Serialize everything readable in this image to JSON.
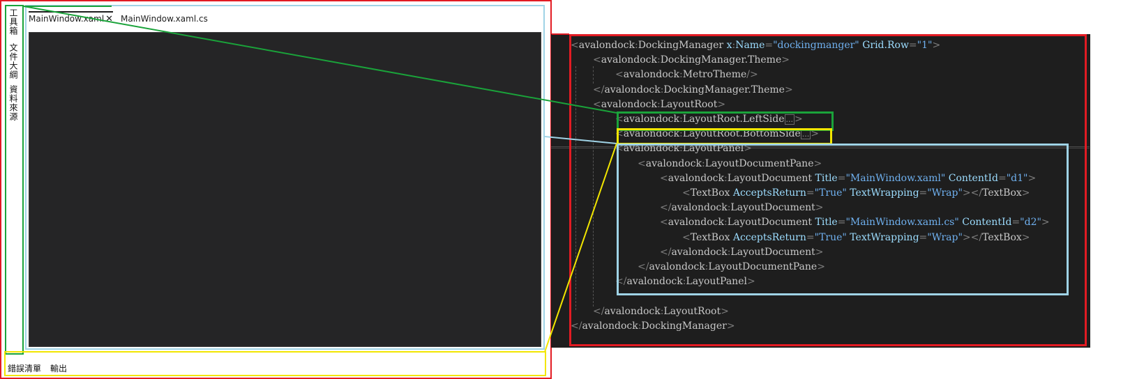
{
  "app_window": {
    "tabs": [
      {
        "label": "MainWindow.xaml",
        "close": "✕",
        "active": true
      },
      {
        "label": "MainWindow.xaml.cs",
        "active": false
      }
    ],
    "left_side": [
      "工具箱",
      "文件大綱",
      "資料來源"
    ],
    "bottom_side": [
      "錯誤清單",
      "輸出"
    ]
  },
  "code": {
    "lines": [
      {
        "indent": 0,
        "html": "<span class=\"p\">&lt;</span><span class=\"ns\">avalondock</span><span class=\"p\">:</span><span class=\"t\">DockingManager</span> <span class=\"a\">x</span><span class=\"p\">:</span><span class=\"a\">Name</span><span class=\"p\">=</span><span class=\"s\">\"dockingmanger\"</span> <span class=\"a\">Grid.Row</span><span class=\"p\">=</span><span class=\"s\">\"1\"</span><span class=\"p\">&gt;</span>"
      },
      {
        "indent": 1,
        "html": "<span class=\"p\">&lt;</span><span class=\"ns\">avalondock</span><span class=\"p\">:</span><span class=\"t\">DockingManager.Theme</span><span class=\"p\">&gt;</span>"
      },
      {
        "indent": 2,
        "html": "<span class=\"p\">&lt;</span><span class=\"ns\">avalondock</span><span class=\"p\">:</span><span class=\"t\">MetroTheme</span><span class=\"p\">/&gt;</span>"
      },
      {
        "indent": 1,
        "html": "<span class=\"p\">&lt;/</span><span class=\"ns\">avalondock</span><span class=\"p\">:</span><span class=\"t\">DockingManager.Theme</span><span class=\"p\">&gt;</span>"
      },
      {
        "indent": 1,
        "html": "<span class=\"p\">&lt;</span><span class=\"ns\">avalondock</span><span class=\"p\">:</span><span class=\"t\">LayoutRoot</span><span class=\"p\">&gt;</span>"
      },
      {
        "indent": 2,
        "html": "<span class=\"p\">&lt;</span><span class=\"ns\">avalondock</span><span class=\"p\">:</span><span class=\"t\">LayoutRoot.LeftSide</span><span class=\"ell\">...</span><span class=\"p\">&gt;</span>"
      },
      {
        "indent": 2,
        "html": "<span class=\"p\">&lt;</span><span class=\"ns\">avalondock</span><span class=\"p\">:</span><span class=\"t\">LayoutRoot.BottomSide</span><span class=\"ell\">...</span><span class=\"p\">&gt;</span>"
      },
      {
        "indent": 2,
        "html": "<span class=\"p\">&lt;</span><span class=\"ns\">avalondock</span><span class=\"p\">:</span><span class=\"t\">LayoutPanel</span><span class=\"p\">&gt;</span>"
      },
      {
        "indent": 3,
        "html": "<span class=\"p\">&lt;</span><span class=\"ns\">avalondock</span><span class=\"p\">:</span><span class=\"t\">LayoutDocumentPane</span><span class=\"p\">&gt;</span>"
      },
      {
        "indent": 4,
        "html": "<span class=\"p\">&lt;</span><span class=\"ns\">avalondock</span><span class=\"p\">:</span><span class=\"t\">LayoutDocument</span> <span class=\"a\">Title</span><span class=\"p\">=</span><span class=\"s\">\"MainWindow.xaml\"</span> <span class=\"a\">ContentId</span><span class=\"p\">=</span><span class=\"s\">\"d1\"</span><span class=\"p\">&gt;</span>"
      },
      {
        "indent": 5,
        "html": "<span class=\"p\">&lt;</span><span class=\"t\">TextBox</span> <span class=\"a\">AcceptsReturn</span><span class=\"p\">=</span><span class=\"s\">\"True\"</span> <span class=\"a\">TextWrapping</span><span class=\"p\">=</span><span class=\"s\">\"Wrap\"</span><span class=\"p\">&gt;&lt;/</span><span class=\"t\">TextBox</span><span class=\"p\">&gt;</span>"
      },
      {
        "indent": 4,
        "html": "<span class=\"p\">&lt;/</span><span class=\"ns\">avalondock</span><span class=\"p\">:</span><span class=\"t\">LayoutDocument</span><span class=\"p\">&gt;</span>"
      },
      {
        "indent": 4,
        "html": "<span class=\"p\">&lt;</span><span class=\"ns\">avalondock</span><span class=\"p\">:</span><span class=\"t\">LayoutDocument</span> <span class=\"a\">Title</span><span class=\"p\">=</span><span class=\"s\">\"MainWindow.xaml.cs\"</span> <span class=\"a\">ContentId</span><span class=\"p\">=</span><span class=\"s\">\"d2\"</span><span class=\"p\">&gt;</span>"
      },
      {
        "indent": 5,
        "html": "<span class=\"p\">&lt;</span><span class=\"t\">TextBox</span> <span class=\"a\">AcceptsReturn</span><span class=\"p\">=</span><span class=\"s\">\"True\"</span> <span class=\"a\">TextWrapping</span><span class=\"p\">=</span><span class=\"s\">\"Wrap\"</span><span class=\"p\">&gt;&lt;/</span><span class=\"t\">TextBox</span><span class=\"p\">&gt;</span>"
      },
      {
        "indent": 4,
        "html": "<span class=\"p\">&lt;/</span><span class=\"ns\">avalondock</span><span class=\"p\">:</span><span class=\"t\">LayoutDocument</span><span class=\"p\">&gt;</span>"
      },
      {
        "indent": 3,
        "html": "<span class=\"p\">&lt;/</span><span class=\"ns\">avalondock</span><span class=\"p\">:</span><span class=\"t\">LayoutDocumentPane</span><span class=\"p\">&gt;</span>"
      },
      {
        "indent": 2,
        "html": "<span class=\"p\">&lt;/</span><span class=\"ns\">avalondock</span><span class=\"p\">:</span><span class=\"t\">LayoutPanel</span><span class=\"p\">&gt;</span>"
      },
      {
        "indent": 0,
        "html": ""
      },
      {
        "indent": 1,
        "html": "<span class=\"p\">&lt;/</span><span class=\"ns\">avalondock</span><span class=\"p\">:</span><span class=\"t\">LayoutRoot</span><span class=\"p\">&gt;</span>"
      },
      {
        "indent": 0,
        "html": "<span class=\"p\">&lt;/</span><span class=\"ns\">avalondock</span><span class=\"p\">:</span><span class=\"t\">DockingManager</span><span class=\"p\">&gt;</span>"
      }
    ]
  },
  "colors": {
    "frame": "#e21b23",
    "left_side": "#1aa33a",
    "bottom_side": "#f2e600",
    "layout_panel": "#9fd3e6",
    "editor_bg": "#1e1e1e"
  }
}
